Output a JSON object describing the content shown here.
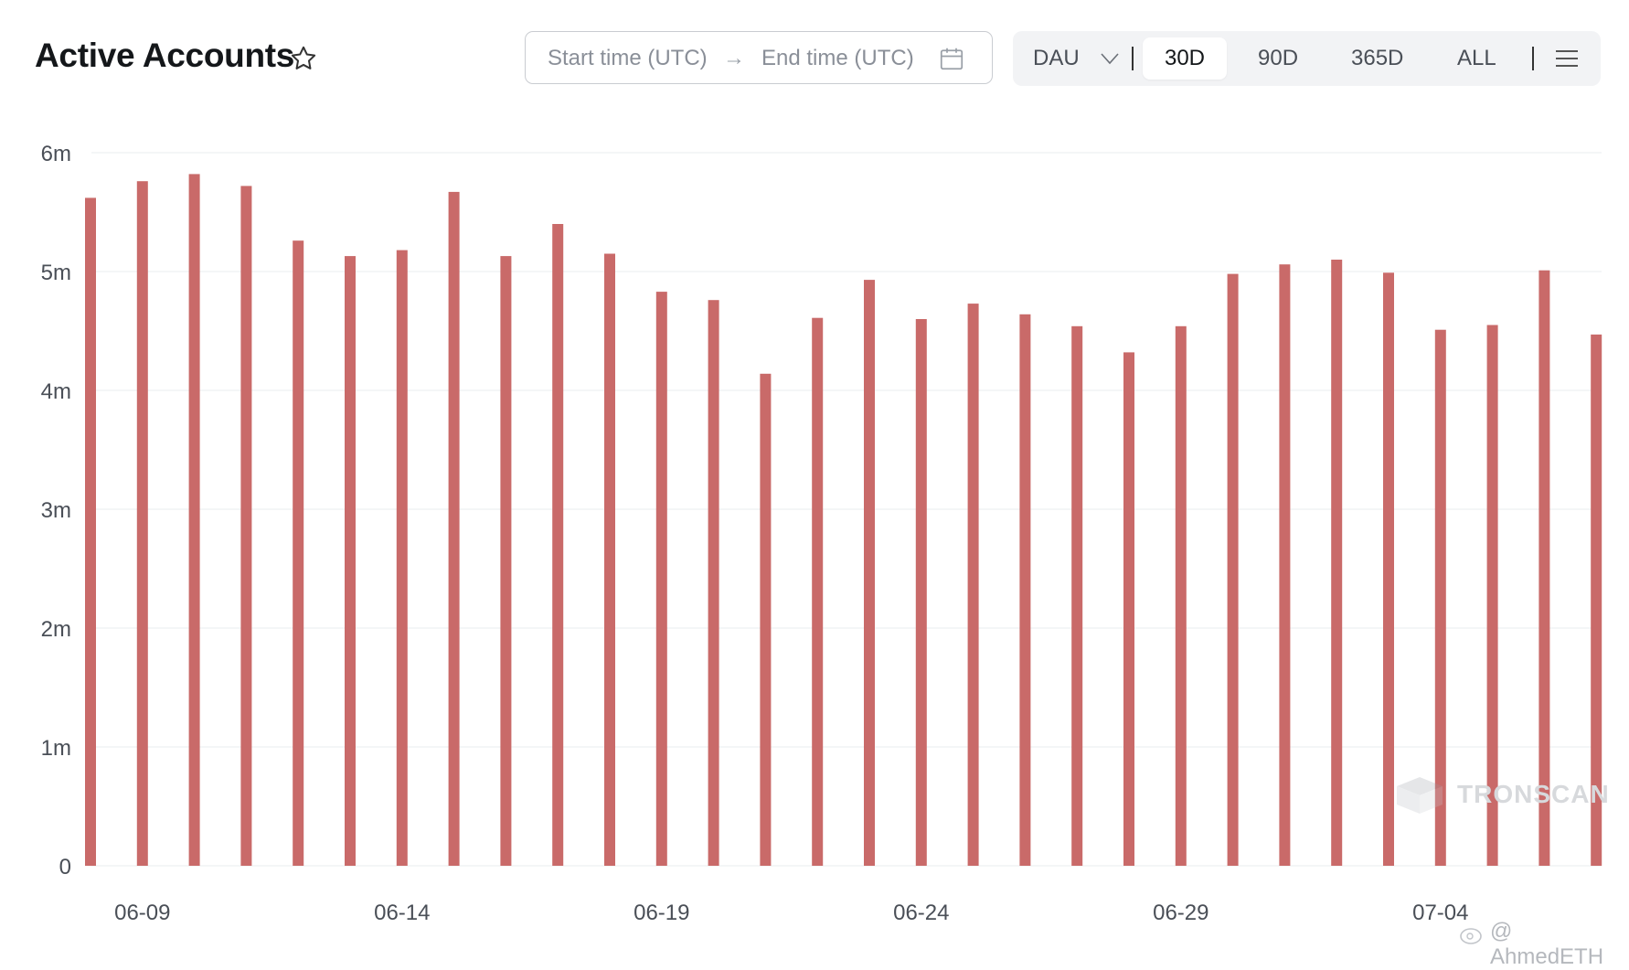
{
  "header": {
    "title": "Active Accounts",
    "favorite_icon": "star-outline-icon",
    "date_range": {
      "start_placeholder": "Start time (UTC)",
      "separator_icon": "arrow-right-icon",
      "end_placeholder": "End time (UTC)",
      "calendar_icon": "calendar-icon"
    },
    "toolbar": {
      "metric_select": "DAU",
      "metric_icon": "chevron-down-icon",
      "ranges": [
        "30D",
        "90D",
        "365D",
        "ALL"
      ],
      "active_range": "30D",
      "menu_icon": "hamburger-menu-icon"
    }
  },
  "watermark": "TRONSCAN",
  "credit": "@ AhmedETH",
  "colors": {
    "bar": "#c96a69",
    "grid": "#eef0f2",
    "axis_text": "#4a4f57",
    "toolbar_bg": "#f2f3f5"
  },
  "chart_data": {
    "type": "bar",
    "title": "Active Accounts",
    "xlabel": "",
    "ylabel": "",
    "ylim": [
      0,
      6000000
    ],
    "yticks": [
      0,
      1000000,
      2000000,
      3000000,
      4000000,
      5000000,
      6000000
    ],
    "ytick_labels": [
      "0",
      "1m",
      "2m",
      "3m",
      "4m",
      "5m",
      "6m"
    ],
    "grid": true,
    "legend": "none",
    "xtick_labels": [
      "06-09",
      "06-14",
      "06-19",
      "06-24",
      "06-29",
      "07-04"
    ],
    "categories": [
      "06-08",
      "06-09",
      "06-10",
      "06-11",
      "06-12",
      "06-13",
      "06-14",
      "06-15",
      "06-16",
      "06-17",
      "06-18",
      "06-19",
      "06-20",
      "06-21",
      "06-22",
      "06-23",
      "06-24",
      "06-25",
      "06-26",
      "06-27",
      "06-28",
      "06-29",
      "06-30",
      "07-01",
      "07-02",
      "07-03",
      "07-04",
      "07-05",
      "07-06",
      "07-07"
    ],
    "values": [
      5620000,
      5760000,
      5820000,
      5720000,
      5260000,
      5130000,
      5180000,
      5670000,
      5130000,
      5400000,
      5150000,
      4830000,
      4760000,
      4140000,
      4610000,
      4930000,
      4600000,
      4730000,
      4640000,
      4540000,
      4320000,
      4540000,
      4980000,
      5060000,
      5100000,
      4990000,
      4510000,
      4550000,
      5010000,
      4470000
    ]
  }
}
